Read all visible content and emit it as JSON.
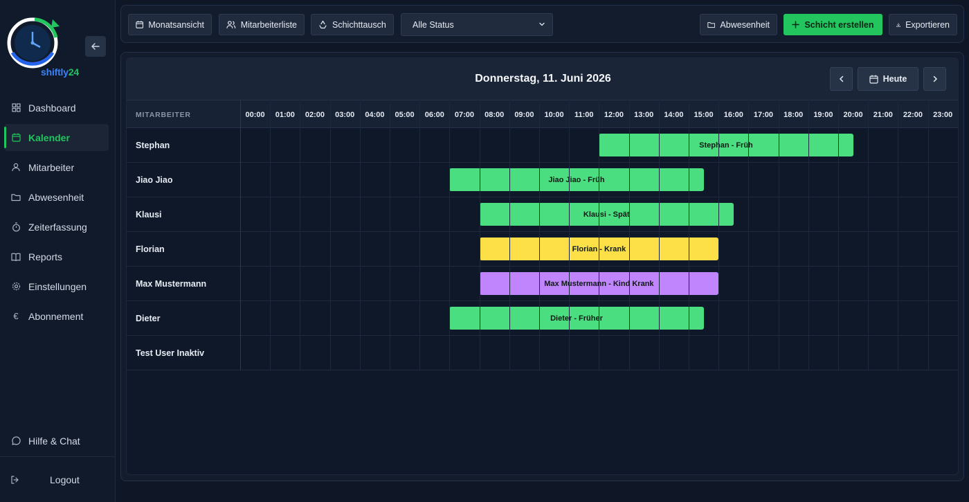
{
  "app": {
    "logo_text_a": "shiftly",
    "logo_text_b": "24",
    "collapse_icon": "arrow-left-icon"
  },
  "sidebar": {
    "items": [
      {
        "label": "Dashboard",
        "icon": "grid-icon"
      },
      {
        "label": "Kalender",
        "icon": "calendar-icon",
        "active": true
      },
      {
        "label": "Mitarbeiter",
        "icon": "user-icon"
      },
      {
        "label": "Abwesenheit",
        "icon": "folder-icon"
      },
      {
        "label": "Zeiterfassung",
        "icon": "stopwatch-icon"
      },
      {
        "label": "Reports",
        "icon": "book-icon"
      },
      {
        "label": "Einstellungen",
        "icon": "gear-icon"
      },
      {
        "label": "Abonnement",
        "icon": "euro-icon"
      }
    ],
    "help_label": "Hilfe & Chat",
    "logout_label": "Logout"
  },
  "toolbar": {
    "month_view": "Monatsansicht",
    "employee_list": "Mitarbeiterliste",
    "shift_swap": "Schichttausch",
    "status_filter": "Alle Status",
    "absence": "Abwesenheit",
    "create_shift": "Schicht erstellen",
    "export": "Exportieren"
  },
  "calendar": {
    "title": "Donnerstag, 11. Juni 2026",
    "today_label": "Heute",
    "employee_column": "MITARBEITER",
    "hours": [
      "00:00",
      "01:00",
      "02:00",
      "03:00",
      "04:00",
      "05:00",
      "06:00",
      "07:00",
      "08:00",
      "09:00",
      "10:00",
      "11:00",
      "12:00",
      "13:00",
      "14:00",
      "15:00",
      "16:00",
      "17:00",
      "18:00",
      "19:00",
      "20:00",
      "21:00",
      "22:00",
      "23:00"
    ],
    "employees": [
      "Stephan",
      "Jiao Jiao",
      "Klausi",
      "Florian",
      "Max Mustermann",
      "Dieter",
      "Test User Inaktiv"
    ],
    "shifts": [
      {
        "row": 0,
        "start": 12.0,
        "end": 20.5,
        "label": "Stephan - Früh",
        "color": "#4ade80"
      },
      {
        "row": 1,
        "start": 7.0,
        "end": 15.5,
        "label": "Jiao Jiao - Früh",
        "color": "#4ade80"
      },
      {
        "row": 2,
        "start": 8.0,
        "end": 16.5,
        "label": "Klausi - Spät",
        "color": "#4ade80"
      },
      {
        "row": 3,
        "start": 8.0,
        "end": 16.0,
        "label": "Florian - Krank",
        "color": "#fde047"
      },
      {
        "row": 4,
        "start": 8.0,
        "end": 16.0,
        "label": "Max Mustermann - Kind Krank",
        "color": "#c084fc"
      },
      {
        "row": 5,
        "start": 7.0,
        "end": 15.5,
        "label": "Dieter - Früher",
        "color": "#4ade80"
      }
    ]
  },
  "colors": {
    "accent": "#22c55e",
    "background": "#0f1726"
  }
}
